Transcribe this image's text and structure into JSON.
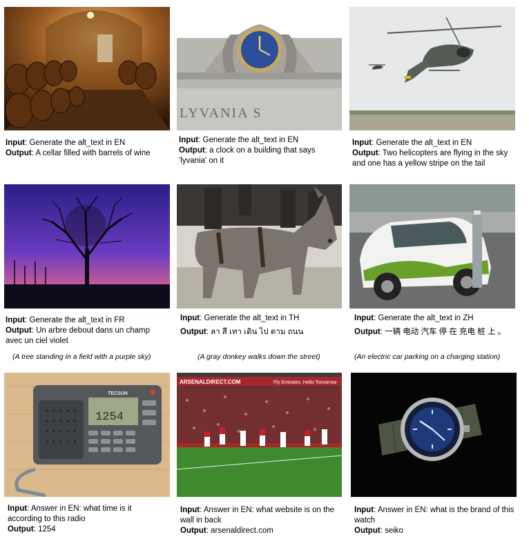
{
  "labels": {
    "input": "Input",
    "output": "Output"
  },
  "cells": [
    {
      "input": "Generate the alt_text in EN",
      "output": "A cellar filled with barrels of wine",
      "translation": ""
    },
    {
      "input": "Generate the alt_text in EN",
      "output": "a clock on a building that says 'lyvania' on it",
      "translation": "",
      "sign_text": "LYVANIA   S"
    },
    {
      "input": "Generate the alt_text in EN",
      "output": "Two helicopters are flying in the sky and one has a yellow stripe on the tail",
      "translation": ""
    },
    {
      "input": "Generate the alt_text in FR",
      "output": "Un arbre debout dans un champ avec un ciel violet",
      "translation": "(A tree standing in a field with a purple sky)"
    },
    {
      "input": "Generate the alt_text in TH",
      "output": "ลา สี เทา เดิน ไป ตาม ถนน",
      "translation": "(A gray donkey walks down the street)"
    },
    {
      "input": "Generate the alt_text in ZH",
      "output": "一辆 电动 汽车 停 在 充电 桩 上 。",
      "translation": "(An electric car parking on a charging station)"
    },
    {
      "input": "Answer in EN: what time is it according to this radio",
      "output": "1254",
      "translation": "",
      "radio_brand": "TECSUN",
      "radio_display": "1254"
    },
    {
      "input": "Answer in EN: what website is on the wall in back",
      "output": "arsenaldirect.com",
      "translation": "",
      "banner_left": "ARSENALDIRECT.COM",
      "banner_right": "Fly Emirates. Hello Tomorrow"
    },
    {
      "input": "Answer in EN: what is the brand of this watch",
      "output": "seiko",
      "translation": ""
    }
  ],
  "colors": {
    "text": "#000000",
    "background": "#ffffff"
  }
}
